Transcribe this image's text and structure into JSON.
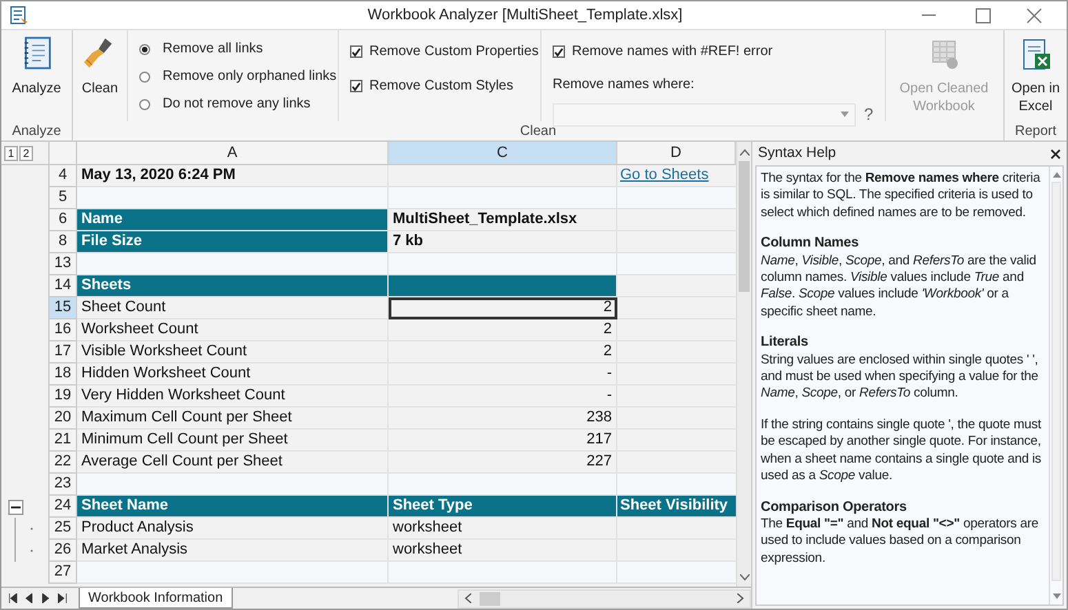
{
  "window": {
    "title": "Workbook Analyzer [MultiSheet_Template.xlsx]"
  },
  "ribbon": {
    "groups": [
      {
        "label": "Analyze"
      },
      {
        "label": "Clean"
      },
      {
        "label": "Report"
      }
    ],
    "analyze_button": "Analyze",
    "clean_button": "Clean",
    "link_options": [
      {
        "label": "Remove all links",
        "selected": true
      },
      {
        "label": "Remove only orphaned links",
        "selected": false
      },
      {
        "label": "Do not remove any links",
        "selected": false
      }
    ],
    "checkboxes": [
      {
        "label": "Remove Custom Properties",
        "checked": true
      },
      {
        "label": "Remove Custom Styles",
        "checked": true
      },
      {
        "label": "Remove names with #REF! error",
        "checked": true
      }
    ],
    "names_where_label": "Remove names where:",
    "help_button": "?",
    "open_cleaned_button": {
      "label": "Open Cleaned Workbook",
      "disabled": true
    },
    "open_excel_button": {
      "label": "Open in Excel",
      "disabled": false
    }
  },
  "grid": {
    "outline_levels": [
      "1",
      "2"
    ],
    "columns": [
      {
        "label": "A",
        "selected": false
      },
      {
        "label": "C",
        "selected": true
      },
      {
        "label": "D",
        "selected": false
      }
    ],
    "rows": [
      {
        "number": "4",
        "kind": "title",
        "selected": false,
        "a": "May 13, 2020 6:24 PM",
        "d": "Go to Sheets"
      },
      {
        "number": "5",
        "kind": "blank",
        "selected": false
      },
      {
        "number": "6",
        "kind": "field",
        "selected": false,
        "a": "Name",
        "c": "MultiSheet_Template.xlsx"
      },
      {
        "number": "8",
        "kind": "field",
        "selected": false,
        "a": "File Size",
        "c": "7 kb"
      },
      {
        "number": "13",
        "kind": "blank",
        "selected": false
      },
      {
        "number": "14",
        "kind": "section",
        "selected": false,
        "a": "Sheets"
      },
      {
        "number": "15",
        "kind": "stat",
        "selected": true,
        "a": "Sheet Count",
        "c": "2"
      },
      {
        "number": "16",
        "kind": "stat",
        "selected": false,
        "a": "Worksheet Count",
        "c": "2"
      },
      {
        "number": "17",
        "kind": "stat",
        "selected": false,
        "a": "Visible Worksheet Count",
        "c": "2"
      },
      {
        "number": "18",
        "kind": "stat",
        "selected": false,
        "a": "Hidden Worksheet Count",
        "c": "-"
      },
      {
        "number": "19",
        "kind": "stat",
        "selected": false,
        "a": "Very Hidden Worksheet Count",
        "c": "-"
      },
      {
        "number": "20",
        "kind": "stat",
        "selected": false,
        "a": "Maximum Cell Count per Sheet",
        "c": "238"
      },
      {
        "number": "21",
        "kind": "stat",
        "selected": false,
        "a": "Minimum Cell Count per Sheet",
        "c": "217"
      },
      {
        "number": "22",
        "kind": "stat",
        "selected": false,
        "a": "Average Cell Count per Sheet",
        "c": "227"
      },
      {
        "number": "23",
        "kind": "blank",
        "selected": false
      },
      {
        "number": "24",
        "kind": "table_header",
        "selected": false,
        "expanded": true,
        "a": "Sheet Name",
        "c": "Sheet Type",
        "d": "Sheet Visibility"
      },
      {
        "number": "25",
        "kind": "table_row",
        "selected": false,
        "a": "Product Analysis",
        "c": "worksheet"
      },
      {
        "number": "26",
        "kind": "table_row",
        "selected": false,
        "a": "Market Analysis",
        "c": "worksheet"
      },
      {
        "number": "27",
        "kind": "blank",
        "selected": false
      }
    ],
    "sheet_tabs": [
      {
        "label": "Workbook Information",
        "selected": true
      }
    ]
  },
  "help": {
    "title": "Syntax Help",
    "blocks": [
      {
        "kind": "text",
        "text": "The syntax for the **Remove names where** criteria is similar to SQL. The specified criteria is used to select which defined names are to be removed."
      },
      {
        "kind": "heading",
        "text": "Column Names"
      },
      {
        "kind": "text",
        "text": "*Name*, *Visible*, *Scope*, and *RefersTo* are the valid column names. *Visible* values include *True* and *False*. *Scope* values include *'Workbook'* or a specific sheet name."
      },
      {
        "kind": "heading",
        "text": "Literals"
      },
      {
        "kind": "text",
        "text": "String values are enclosed within single quotes ' ', and must be used when specifying a value for the *Name*, *Scope*, or *RefersTo* column."
      },
      {
        "kind": "text",
        "text": "If the string contains single quote ', the quote must be escaped by another single quote. For instance, when a sheet name contains a single quote and is used as a *Scope* value."
      },
      {
        "kind": "heading",
        "text": "Comparison Operators"
      },
      {
        "kind": "text",
        "text": "The **Equal \"=\"** and **Not equal \"<>\"** operators are used to include values based on a comparison expression."
      }
    ]
  }
}
